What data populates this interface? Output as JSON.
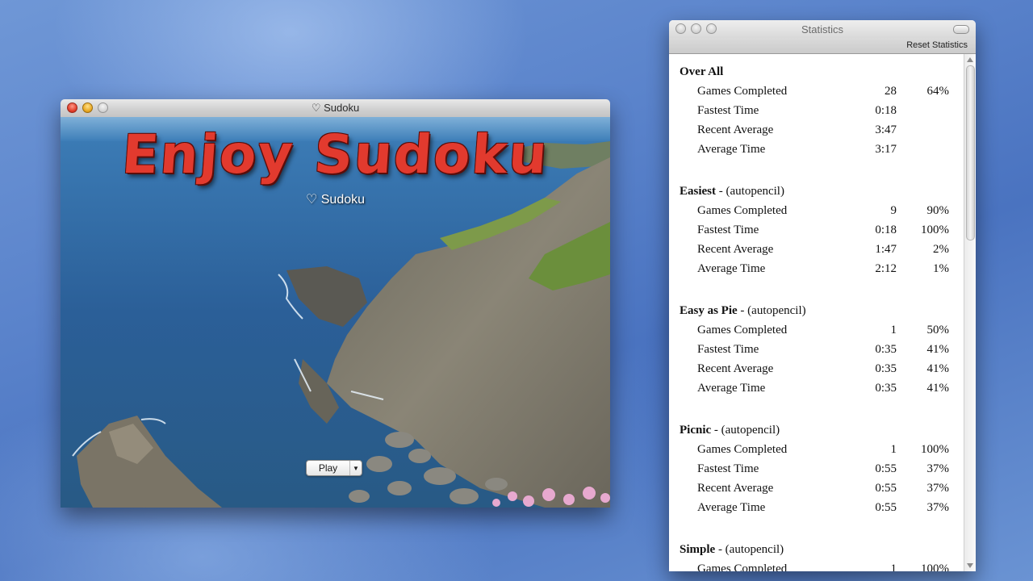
{
  "sudoku": {
    "window_title": "♡ Sudoku",
    "headline": "Enjoy Sudoku",
    "subtitle": "♡ Sudoku",
    "play_label": "Play"
  },
  "stats": {
    "window_title": "Statistics",
    "reset_label": "Reset Statistics",
    "sections": [
      {
        "name": "Over All",
        "qualifier": "",
        "rows": [
          {
            "label": "Games Completed",
            "v1": "28",
            "v2": "64%"
          },
          {
            "label": "Fastest Time",
            "v1": "0:18",
            "v2": ""
          },
          {
            "label": "Recent Average",
            "v1": "3:47",
            "v2": ""
          },
          {
            "label": "Average Time",
            "v1": "3:17",
            "v2": ""
          }
        ]
      },
      {
        "name": "Easiest",
        "qualifier": " - (autopencil)",
        "rows": [
          {
            "label": "Games Completed",
            "v1": "9",
            "v2": "90%"
          },
          {
            "label": "Fastest Time",
            "v1": "0:18",
            "v2": "100%"
          },
          {
            "label": "Recent Average",
            "v1": "1:47",
            "v2": "2%"
          },
          {
            "label": "Average Time",
            "v1": "2:12",
            "v2": "1%"
          }
        ]
      },
      {
        "name": "Easy as Pie",
        "qualifier": " - (autopencil)",
        "rows": [
          {
            "label": "Games Completed",
            "v1": "1",
            "v2": "50%"
          },
          {
            "label": "Fastest Time",
            "v1": "0:35",
            "v2": "41%"
          },
          {
            "label": "Recent Average",
            "v1": "0:35",
            "v2": "41%"
          },
          {
            "label": "Average Time",
            "v1": "0:35",
            "v2": "41%"
          }
        ]
      },
      {
        "name": "Picnic",
        "qualifier": " - (autopencil)",
        "rows": [
          {
            "label": "Games Completed",
            "v1": "1",
            "v2": "100%"
          },
          {
            "label": "Fastest Time",
            "v1": "0:55",
            "v2": "37%"
          },
          {
            "label": "Recent Average",
            "v1": "0:55",
            "v2": "37%"
          },
          {
            "label": "Average Time",
            "v1": "0:55",
            "v2": "37%"
          }
        ]
      },
      {
        "name": "Simple",
        "qualifier": " - (autopencil)",
        "rows": [
          {
            "label": "Games Completed",
            "v1": "1",
            "v2": "100%"
          }
        ]
      }
    ]
  }
}
